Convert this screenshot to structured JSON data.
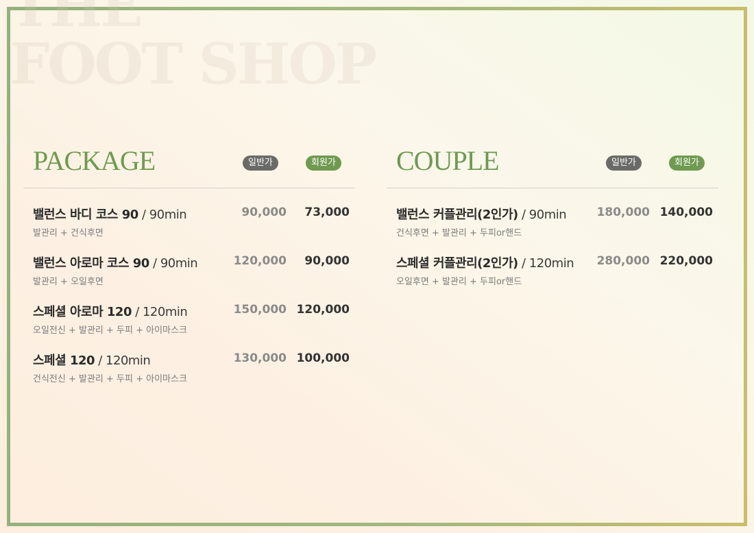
{
  "watermark": "THE\nFOOT SHOP",
  "badges": {
    "regular": "일반가",
    "member": "회원가"
  },
  "colors": {
    "accent": "#6f9a50",
    "badge_gray": "#6a6a66",
    "frame": "#93b17c"
  },
  "package": {
    "title": "PACKAGE",
    "items": [
      {
        "name": "밸런스 바디 코스 90",
        "duration": " / 90min",
        "desc": "발관리 + 건식후면",
        "regular": "90,000",
        "member": "73,000"
      },
      {
        "name": "밸런스 아로마 코스 90",
        "duration": " / 90min",
        "desc": "발관리 + 오일후면",
        "regular": "120,000",
        "member": "90,000"
      },
      {
        "name": "스페셜 아로마 120",
        "duration": " / 120min",
        "desc": "오일전신 + 발관리 + 두피 + 아이마스크",
        "regular": "150,000",
        "member": "120,000"
      },
      {
        "name": "스페셜 120",
        "duration": " / 120min",
        "desc": "건식전신 + 발관리 + 두피 + 아이마스크",
        "regular": "130,000",
        "member": "100,000"
      }
    ]
  },
  "couple": {
    "title": "COUPLE",
    "items": [
      {
        "name": "밸런스 커플관리(2인가)",
        "duration": " / 90min",
        "desc": "건식후면 + 발관리 + 두피or핸드",
        "regular": "180,000",
        "member": "140,000"
      },
      {
        "name": "스페셜 커플관리(2인가)",
        "duration": " / 120min",
        "desc": "오일후면 + 발관리 + 두피or핸드",
        "regular": "280,000",
        "member": "220,000"
      }
    ]
  }
}
